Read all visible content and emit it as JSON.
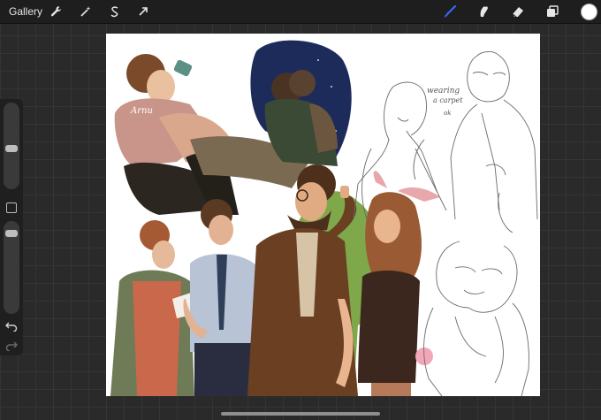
{
  "topbar": {
    "gallery_label": "Gallery",
    "left_tools": [
      "wrench-icon",
      "magic-wand-icon",
      "selection-icon",
      "transform-arrow-icon"
    ],
    "right_tools": [
      "brush-icon",
      "smudge-icon",
      "eraser-icon",
      "layers-icon"
    ],
    "active_tool": "brush-icon",
    "active_tool_color": "#2f6cf5",
    "current_color": "#ffffff"
  },
  "sidebar": {
    "brush_size_level": 0.62,
    "opacity_level": 0.9,
    "controls": [
      "brush-size-slider",
      "modify-square",
      "opacity-slider",
      "undo-icon",
      "redo-icon"
    ]
  },
  "canvas": {
    "handwritten_signature": "Arnu",
    "sketch_note_line1": "wearing",
    "sketch_note_line2": "a carpet",
    "sketch_note_line3": "ok"
  }
}
